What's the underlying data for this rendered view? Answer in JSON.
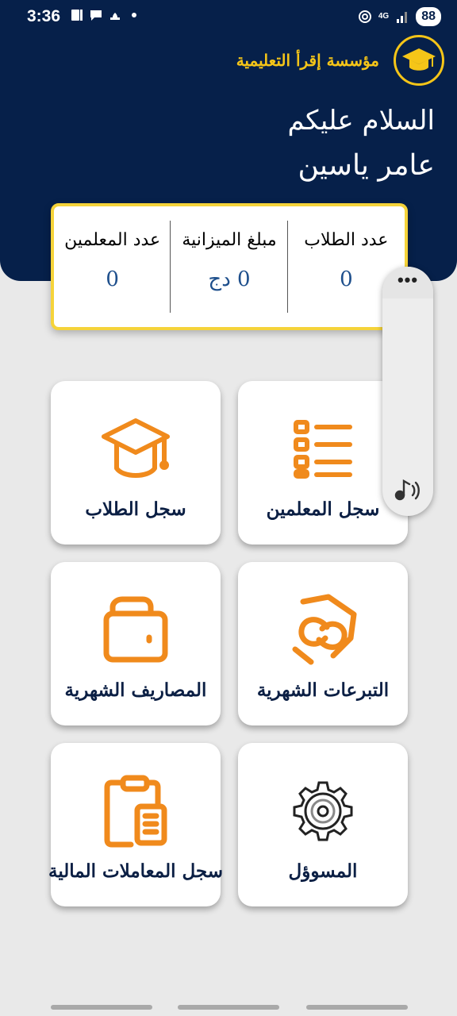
{
  "status_bar": {
    "time": "3:36",
    "network": "4G",
    "battery": "88",
    "icons": [
      "sim-icon",
      "chat-icon",
      "ramadan-icon",
      "dot-icon",
      "hotspot-icon",
      "signal-icon"
    ]
  },
  "header": {
    "org_name": "مؤسسة إقرأ التعليمية",
    "greeting": "السلام عليكم",
    "user_name": "عامر ياسين"
  },
  "stats": [
    {
      "label": "عدد الطلاب",
      "value": "0"
    },
    {
      "label": "مبلغ الميزانية",
      "value": "0 دج"
    },
    {
      "label": "عدد المعلمين",
      "value": "0"
    }
  ],
  "tiles": [
    {
      "label": "سجل المعلمين",
      "icon": "list-icon"
    },
    {
      "label": "سجل الطلاب",
      "icon": "graduation-cap-icon"
    },
    {
      "label": "التبرعات الشهرية",
      "icon": "donation-icon"
    },
    {
      "label": "المصاريف الشهرية",
      "icon": "wallet-icon"
    },
    {
      "label": "المسوؤل",
      "icon": "gear-icon"
    },
    {
      "label": "سجل المعاملات المالية",
      "icon": "clipboard-icon"
    }
  ],
  "side_panel": {
    "menu": "•••"
  },
  "colors": {
    "header_bg": "#06204a",
    "accent": "#f5c518",
    "icon_orange": "#f08a1c",
    "value_blue": "#1e4f8c"
  }
}
